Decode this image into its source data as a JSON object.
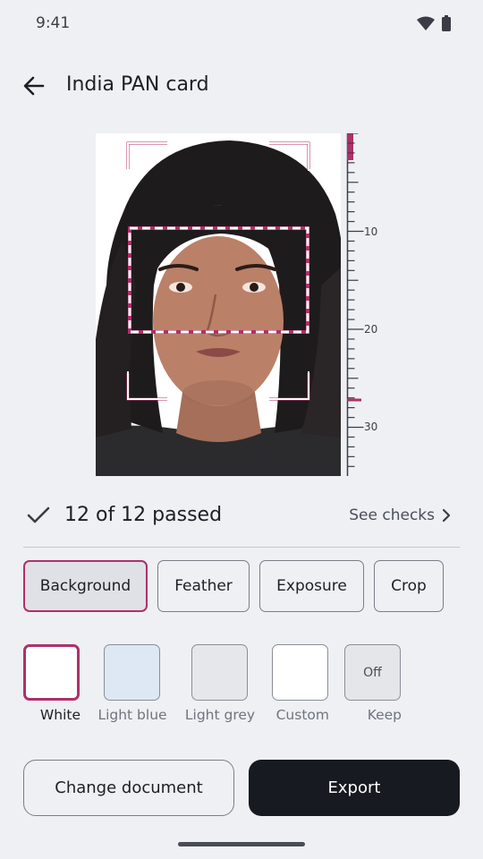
{
  "status": {
    "time": "9:41"
  },
  "header": {
    "title": "India PAN card"
  },
  "ruler": {
    "labels": [
      "10",
      "20",
      "30"
    ]
  },
  "checks": {
    "summary": "12 of 12 passed",
    "link": "See checks"
  },
  "tabs": [
    {
      "label": "Background",
      "active": true
    },
    {
      "label": "Feather",
      "active": false
    },
    {
      "label": "Exposure",
      "active": false
    },
    {
      "label": "Crop",
      "active": false
    }
  ],
  "swatches": [
    {
      "label": "White",
      "color": "#ffffff",
      "selected": true,
      "text": ""
    },
    {
      "label": "Light blue",
      "color": "#dde8f4",
      "selected": false,
      "text": ""
    },
    {
      "label": "Light grey",
      "color": "#e6e7ea",
      "selected": false,
      "text": ""
    },
    {
      "label": "Custom",
      "color": "#ffffff",
      "selected": false,
      "text": ""
    },
    {
      "label": "Keep",
      "color": "#e4e6ea",
      "selected": false,
      "text": "Off"
    }
  ],
  "actions": {
    "change_document": "Change document",
    "export": "Export"
  },
  "colors": {
    "accent": "#b0306a",
    "primary_button": "#171a20",
    "background": "#eef0f4"
  }
}
